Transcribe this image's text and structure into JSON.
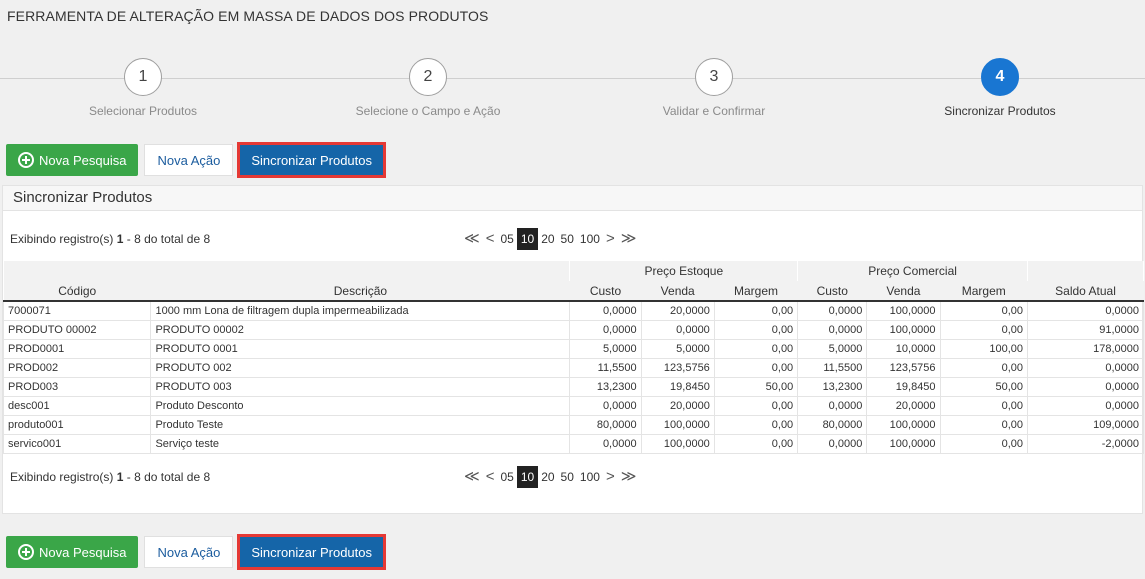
{
  "page": {
    "title": "FERRAMENTA DE ALTERAÇÃO EM MASSA DE DADOS DOS PRODUTOS"
  },
  "wizard": {
    "steps": [
      {
        "number": "1",
        "label": "Selecionar Produtos"
      },
      {
        "number": "2",
        "label": "Selecione o Campo e Ação"
      },
      {
        "number": "3",
        "label": "Validar e Confirmar"
      },
      {
        "number": "4",
        "label": "Sincronizar Produtos"
      }
    ]
  },
  "toolbar": {
    "new_search": "Nova Pesquisa",
    "new_action": "Nova Ação",
    "sync": "Sincronizar Produtos"
  },
  "panel": {
    "title": "Sincronizar Produtos"
  },
  "pager": {
    "info_prefix": "Exibindo registro(s) ",
    "info_range": "1",
    "info_suffix": " - 8 do total de 8",
    "first": "≪",
    "prev": "<",
    "sizes": [
      "05",
      "10",
      "20",
      "50",
      "100"
    ],
    "next": ">",
    "last": "≫"
  },
  "table": {
    "groups": {
      "stock": "Preço Estoque",
      "commercial": "Preço Comercial"
    },
    "columns": [
      "Código",
      "Descrição",
      "Custo",
      "Venda",
      "Margem",
      "Custo",
      "Venda",
      "Margem",
      "Saldo Atual"
    ],
    "rows": [
      [
        "7000071",
        "1000 mm Lona de filtragem dupla impermeabilizada",
        "0,0000",
        "20,0000",
        "0,00",
        "0,0000",
        "100,0000",
        "0,00",
        "0,0000"
      ],
      [
        "PRODUTO 00002",
        "PRODUTO 00002",
        "0,0000",
        "0,0000",
        "0,00",
        "0,0000",
        "100,0000",
        "0,00",
        "91,0000"
      ],
      [
        "PROD0001",
        "PRODUTO 0001",
        "5,0000",
        "5,0000",
        "0,00",
        "5,0000",
        "10,0000",
        "100,00",
        "178,0000"
      ],
      [
        "PROD002",
        "PRODUTO 002",
        "11,5500",
        "123,5756",
        "0,00",
        "11,5500",
        "123,5756",
        "0,00",
        "0,0000"
      ],
      [
        "PROD003",
        "PRODUTO 003",
        "13,2300",
        "19,8450",
        "50,00",
        "13,2300",
        "19,8450",
        "50,00",
        "0,0000"
      ],
      [
        "desc001",
        "Produto Desconto",
        "0,0000",
        "20,0000",
        "0,00",
        "0,0000",
        "20,0000",
        "0,00",
        "0,0000"
      ],
      [
        "produto001",
        "Produto Teste",
        "80,0000",
        "100,0000",
        "0,00",
        "80,0000",
        "100,0000",
        "0,00",
        "109,0000"
      ],
      [
        "servico001",
        "Serviço teste",
        "0,0000",
        "100,0000",
        "0,00",
        "0,0000",
        "100,0000",
        "0,00",
        "-2,0000"
      ]
    ]
  },
  "colors": {
    "accent": "#1976d2",
    "green": "#3aa648",
    "sync_btn": "#1565a8",
    "highlight": "#e53935"
  }
}
